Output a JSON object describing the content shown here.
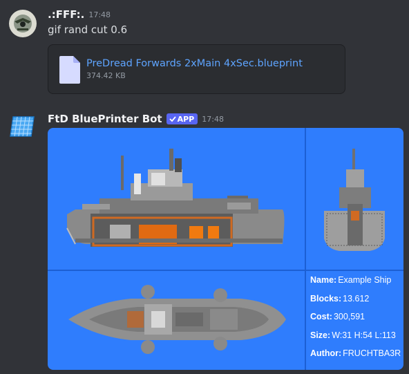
{
  "messages": [
    {
      "username": ".:FFF:.",
      "timestamp": "17:48",
      "text": "gif rand cut 0.6",
      "attachment": {
        "file_name": "PreDread Forwards 2xMain 4xSec.blueprint",
        "file_size": "374.42 KB",
        "icon": "file-icon"
      }
    },
    {
      "username": "FtD BluePrinter Bot",
      "badge": "APP",
      "timestamp": "17:48",
      "embed": {
        "background": "#2f7dfd",
        "stats": [
          {
            "label": "Name:",
            "value": "Example Ship"
          },
          {
            "label": "Blocks:",
            "value": "13.612"
          },
          {
            "label": "Cost:",
            "value": "300,591"
          },
          {
            "label": "Size:",
            "value": "W:31 H:54 L:113"
          },
          {
            "label": "Author:",
            "value": "FRUCHTBA3R"
          }
        ]
      }
    }
  ],
  "colors": {
    "background": "#313338",
    "link": "#5ea4ff",
    "app_badge": "#5865f2",
    "embed_blue": "#2f7dfd"
  }
}
